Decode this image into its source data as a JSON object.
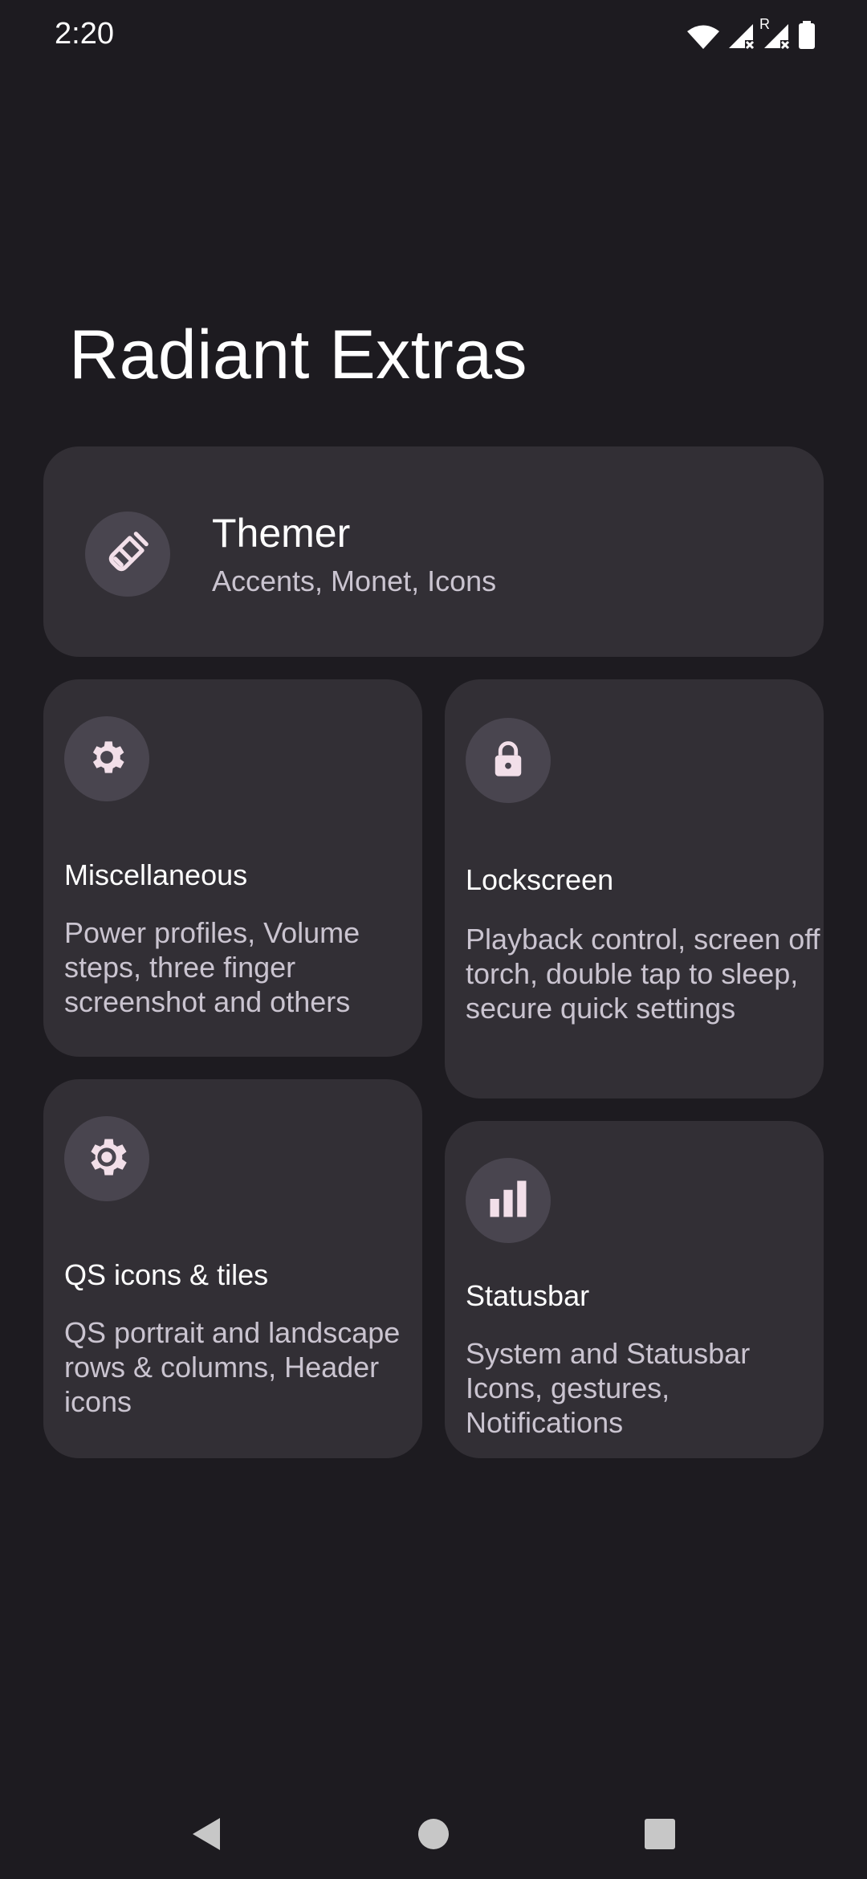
{
  "status_bar": {
    "time": "2:20",
    "icons": [
      "wifi-icon",
      "signal-no-data-icon",
      "roaming-indicator",
      "signal-no-data-icon",
      "battery-icon"
    ],
    "roaming_label": "R"
  },
  "page": {
    "title": "Radiant Extras"
  },
  "cards": {
    "themer": {
      "title": "Themer",
      "description": "Accents, Monet, Icons",
      "icon": "paintbrush-icon"
    },
    "misc": {
      "title": "Miscellaneous",
      "description": "Power profiles, Volume steps, three finger screenshot and others",
      "icon": "gear-icon"
    },
    "lockscreen": {
      "title": "Lockscreen",
      "description": "Playback control, screen off torch, double tap to sleep, secure quick settings",
      "icon": "lock-icon"
    },
    "qs": {
      "title": "QS icons & tiles",
      "description": "QS portrait and landscape rows & columns, Header icons",
      "icon": "settings-cog-icon"
    },
    "statusbar": {
      "title": "Statusbar",
      "description": "System and Statusbar Icons, gestures, Notifications",
      "icon": "bar-chart-icon"
    }
  },
  "nav_bar": {
    "buttons": [
      "back-icon",
      "home-icon",
      "recents-icon"
    ]
  },
  "colors": {
    "background": "#1d1b20",
    "card": "#322f35",
    "icon_circle": "#49454f",
    "icon_fill": "#f2dfe9",
    "secondary_text": "#cac4d0"
  }
}
